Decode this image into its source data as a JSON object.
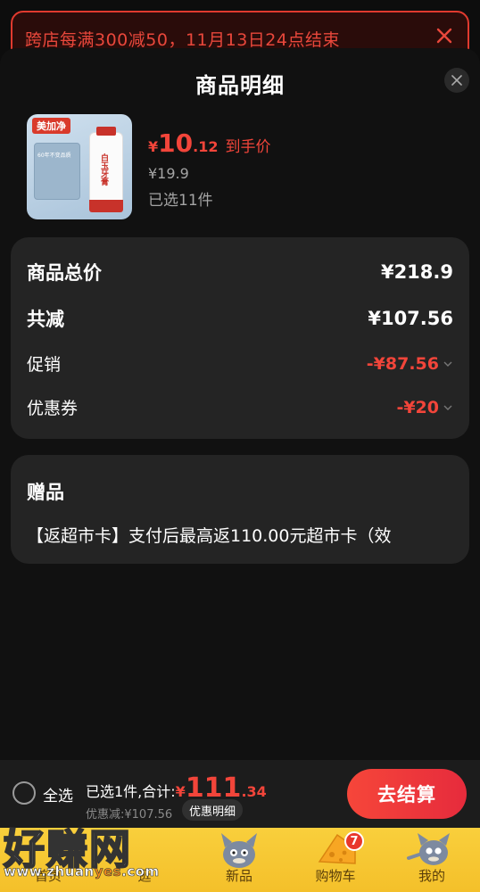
{
  "promo_banner": {
    "text": "跨店每满300减50，11月13日24点结束"
  },
  "sheet": {
    "title": "商品明细"
  },
  "product": {
    "brand": "美加净",
    "box_text": "60年不变品质",
    "tube_text": "白玉牙膏",
    "price_yen": "¥",
    "price_int": "10",
    "price_dec": ".12",
    "price_suffix": "到手价",
    "original_price": "¥19.9",
    "selected_count": "已选11件"
  },
  "summary": {
    "total_label": "商品总价",
    "total_value": "¥218.9",
    "reduce_label": "共减",
    "reduce_value": "¥107.56",
    "promo_label": "促销",
    "promo_value": "-¥87.56",
    "coupon_label": "优惠券",
    "coupon_value": "-¥20"
  },
  "gift": {
    "title": "赠品",
    "text": "【返超市卡】支付后最高返110.00元超市卡（效"
  },
  "bottom_bar": {
    "select_all": "全选",
    "total_prefix": "已选1件,合计:",
    "total_yen": "¥",
    "total_int": "111",
    "total_dec": ".34",
    "discount_text": "优惠减:¥107.56",
    "detail_button": "优惠明细",
    "checkout_button": "去结算"
  },
  "tabbar": {
    "tabs": [
      {
        "label": "首页"
      },
      {
        "label": "逛"
      },
      {
        "label": "新品"
      },
      {
        "label": "购物车"
      },
      {
        "label": "我的"
      }
    ],
    "cart_badge": "7"
  },
  "watermark": {
    "big": "好赚网",
    "url_prefix": "www.zhuan",
    "url_mid": "yes",
    "url_suffix": ".com"
  },
  "colors": {
    "accent": "#f2453a",
    "banner_border": "#e03a2f",
    "card_bg": "#242424",
    "tabbar_bg": "#f9cf3c"
  }
}
